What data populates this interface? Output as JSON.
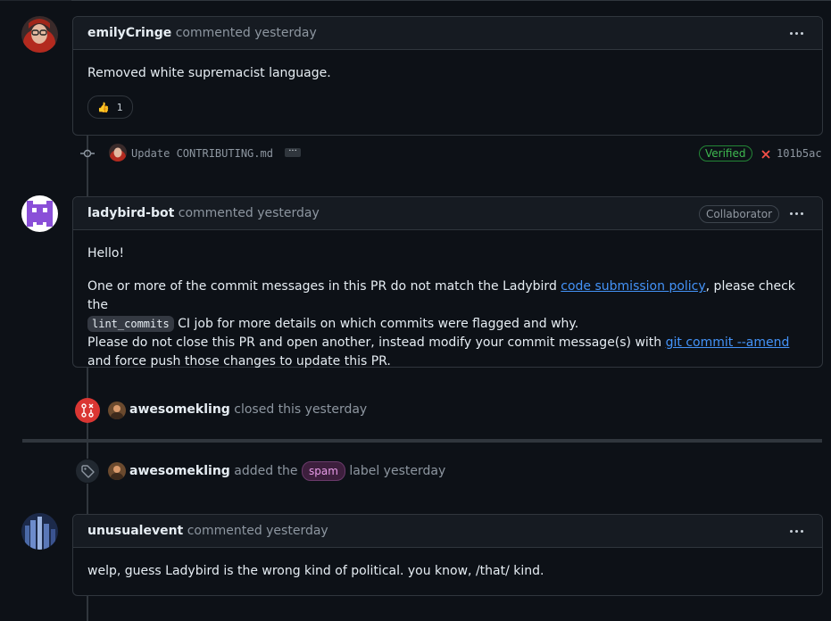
{
  "comment1": {
    "author": "emilyCringe",
    "meta": "commented yesterday",
    "body": "Removed white supremacist language.",
    "reaction_emoji": "👍",
    "reaction_count": "1"
  },
  "commit": {
    "message": "Update CONTRIBUTING.md",
    "ellipsis": "···",
    "verified": "Verified",
    "status_icon": "x-icon",
    "sha": "101b5ac"
  },
  "comment2": {
    "author": "ladybird-bot",
    "meta": "commented yesterday",
    "role": "Collaborator",
    "greeting": "Hello!",
    "p1_a": "One or more of the commit messages in this PR do not match the Ladybird ",
    "p1_link": "code submission policy",
    "p1_b": ", please check the",
    "p1_code": "lint_commits",
    "p1_c": " CI job for more details on which commits were flagged and why.",
    "p2_a": "Please do not close this PR and open another, instead modify your commit message(s) with ",
    "p2_link": "git commit --amend",
    "p2_b": " and force push those changes to update this PR."
  },
  "event_closed": {
    "actor": "awesomekling",
    "text": "closed this yesterday"
  },
  "event_label": {
    "actor": "awesomekling",
    "text_a": "added the",
    "label": "spam",
    "text_b": "label yesterday"
  },
  "comment3": {
    "author": "unusualevent",
    "meta": "commented yesterday",
    "body": "welp, guess Ladybird is the wrong kind of political. you know, /that/ kind."
  },
  "colors": {
    "closed_icon_bg": "#da3633",
    "verified_green": "#3fb950",
    "link_blue": "#4493f8",
    "spam_label": "#e89ce8"
  }
}
